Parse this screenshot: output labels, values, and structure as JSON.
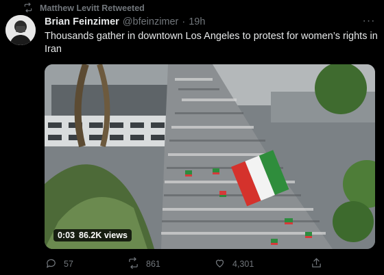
{
  "retweet": {
    "icon": "retweet-icon",
    "text": "Matthew Levitt Retweeted"
  },
  "tweet": {
    "author_name": "Brian Feinzimer",
    "handle": "@bfeinzimer",
    "separator": "·",
    "time": "19h",
    "more": "···",
    "text": "Thousands gather in downtown Los Angeles to protest for women’s rights in Iran"
  },
  "video": {
    "duration": "0:03",
    "views": "86.2K views"
  },
  "actions": {
    "replies": "57",
    "retweets": "861",
    "likes": "4,301"
  },
  "colors": {
    "background": "#000000",
    "secondary_text": "#71767b",
    "primary_text": "#e7e9ea"
  }
}
